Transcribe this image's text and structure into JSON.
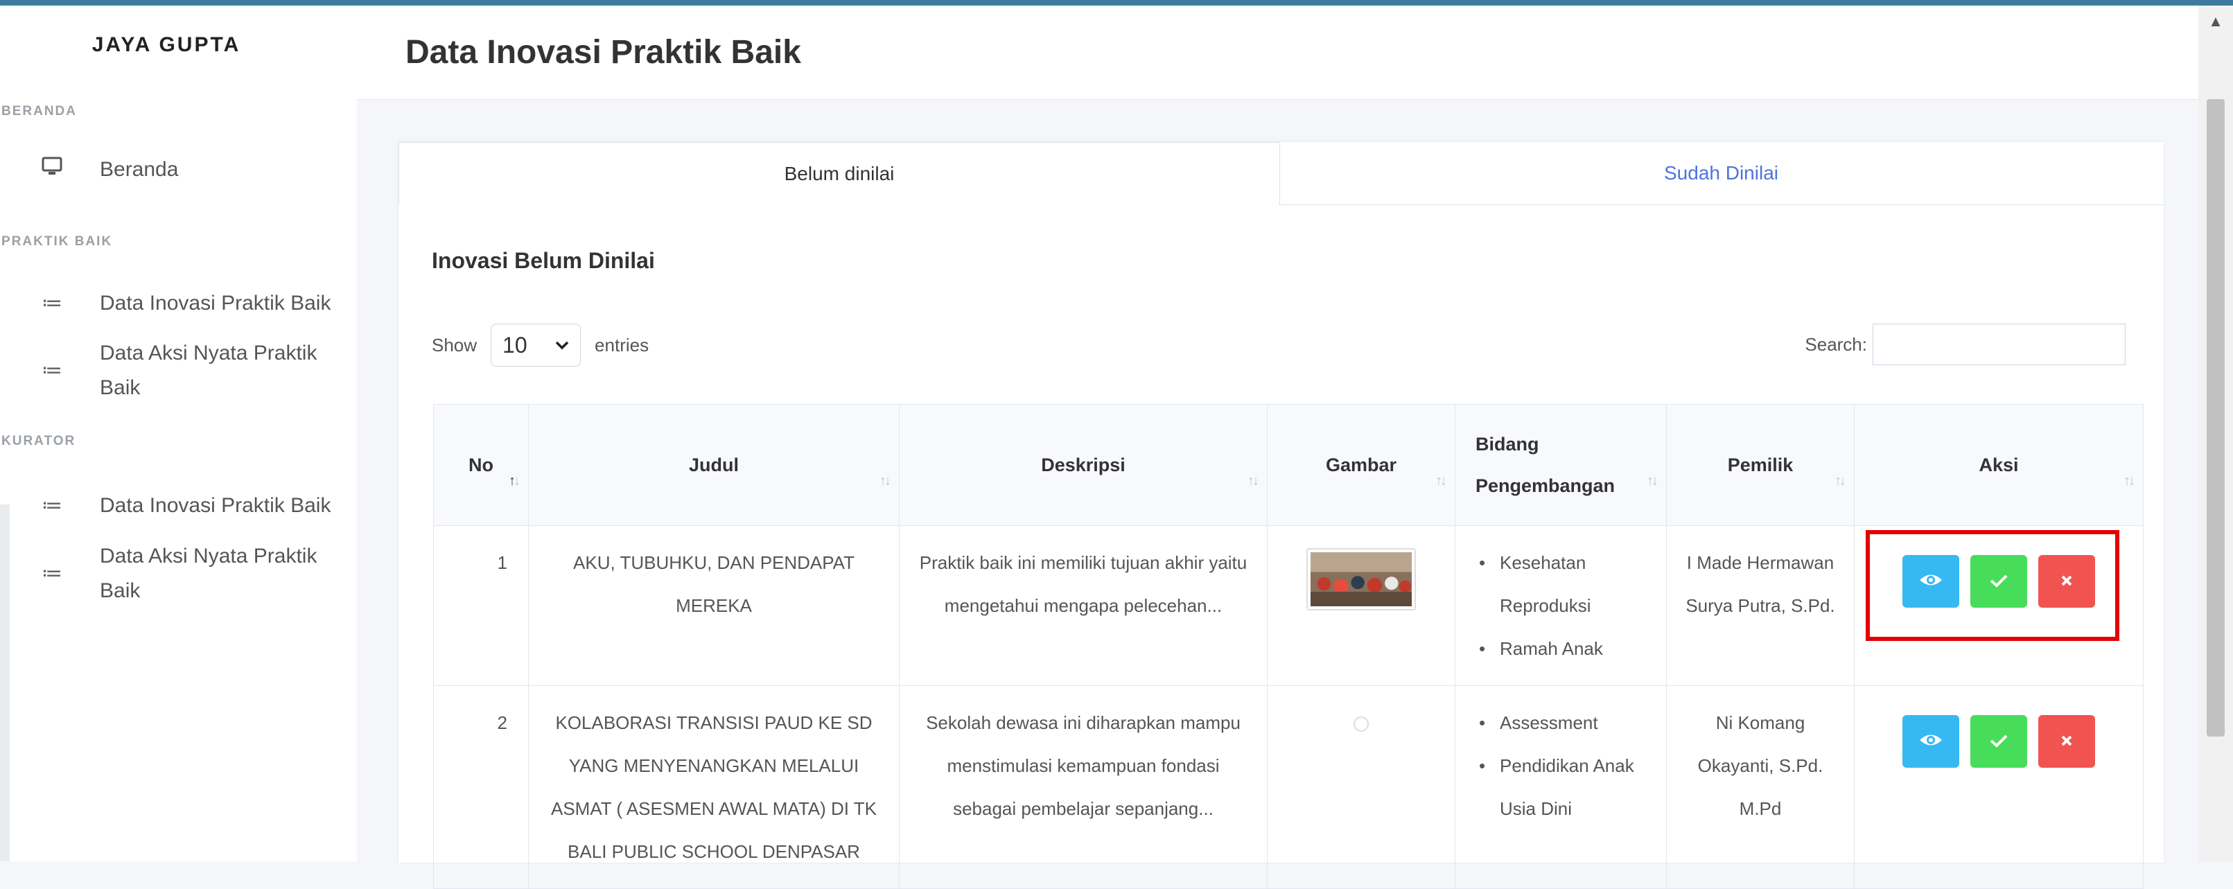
{
  "sidebar": {
    "brand": "JAYA GUPTA",
    "sections": [
      {
        "label": "BERANDA"
      },
      {
        "label": "PRAKTIK BAIK"
      },
      {
        "label": "KURATOR"
      }
    ],
    "items": [
      {
        "label": "Beranda",
        "icon": "desktop-icon"
      },
      {
        "label": "Data Inovasi Praktik Baik",
        "icon": "list-icon"
      },
      {
        "label": "Data Aksi Nyata Praktik Baik",
        "icon": "list-icon"
      },
      {
        "label": "Data Inovasi Praktik Baik",
        "icon": "list-icon"
      },
      {
        "label": "Data Aksi Nyata Praktik Baik",
        "icon": "list-icon"
      }
    ]
  },
  "header": {
    "title": "Data Inovasi Praktik Baik"
  },
  "tabs": [
    {
      "label": "Belum dinilai",
      "active": true
    },
    {
      "label": "Sudah Dinilai",
      "active": false
    }
  ],
  "card": {
    "title": "Inovasi Belum Dinilai"
  },
  "controls": {
    "show_label": "Show",
    "entries_value": "10",
    "entries_label": "entries",
    "search_label": "Search:",
    "search_value": ""
  },
  "table": {
    "headers": [
      "No",
      "Judul",
      "Deskripsi",
      "Gambar",
      "Bidang Pengembangan",
      "Pemilik",
      "Aksi"
    ],
    "header_bidang_line1": "Bidang",
    "header_bidang_line2": "Pengembangan",
    "rows": [
      {
        "no": "1",
        "judul": "AKU, TUBUHKU, DAN PENDAPAT MEREKA",
        "deskripsi": "Praktik baik ini memiliki tujuan akhir yaitu mengetahui mengapa pelecehan...",
        "bidang": [
          "Kesehatan Reproduksi",
          "Ramah Anak"
        ],
        "pemilik": "I Made Hermawan Surya Putra, S.Pd."
      },
      {
        "no": "2",
        "judul": "KOLABORASI TRANSISI PAUD KE SD YANG MENYENANGKAN MELALUI ASMAT ( ASESMEN AWAL MATA) DI TK BALI PUBLIC SCHOOL DENPASAR",
        "deskripsi": "Sekolah dewasa ini diharapkan mampu menstimulasi kemampuan fondasi sebagai pembelajar sepanjang...",
        "bidang": [
          "Assessment",
          "Pendidikan Anak Usia Dini"
        ],
        "pemilik": "Ni Komang Okayanti, S.Pd. M.Pd"
      }
    ]
  },
  "colors": {
    "topbar": "#3d7a9c",
    "view_button": "#36b9f2",
    "approve_button": "#47dd5a",
    "reject_button": "#f15350",
    "highlight_box": "#e30000",
    "link_tab": "#4e73df"
  }
}
